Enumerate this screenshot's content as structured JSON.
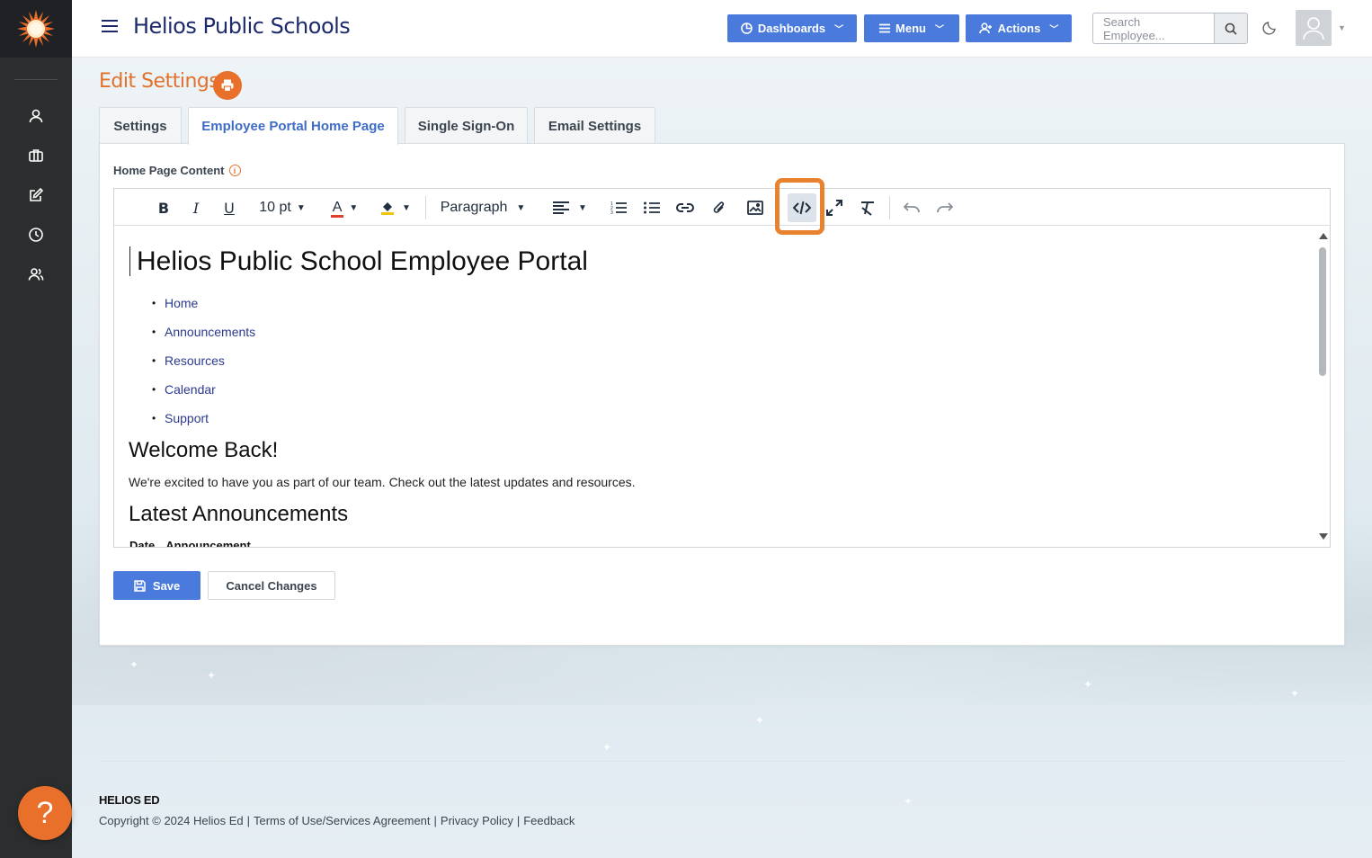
{
  "header": {
    "brand": "Helios Public Schools",
    "dashboards_label": "Dashboards",
    "menu_label": "Menu",
    "actions_label": "Actions",
    "search_placeholder": "Search Employee..."
  },
  "page": {
    "title": "Edit Settings",
    "tabs": [
      {
        "label": "Settings"
      },
      {
        "label": "Employee Portal Home Page"
      },
      {
        "label": "Single Sign-On"
      },
      {
        "label": "Email Settings"
      }
    ],
    "field_label": "Home Page Content"
  },
  "toolbar": {
    "font_size": "10 pt",
    "block_format": "Paragraph",
    "icons": [
      "bold-icon",
      "italic-icon",
      "underline-icon",
      "text-color-icon",
      "highlight-color-icon",
      "align-left-icon",
      "numbered-list-icon",
      "bullet-list-icon",
      "link-icon",
      "attachment-icon",
      "image-icon",
      "source-code-icon",
      "fullscreen-icon",
      "clear-formatting-icon",
      "undo-icon",
      "redo-icon"
    ]
  },
  "editor_content": {
    "heading": "Helios Public School Employee Portal",
    "nav_items": [
      "Home",
      "Announcements",
      "Resources",
      "Calendar",
      "Support"
    ],
    "welcome_heading": "Welcome Back!",
    "welcome_text": "We're excited to have you as part of our team. Check out the latest updates and resources.",
    "announcements_heading": "Latest Announcements",
    "table_headers": [
      "Date",
      "Announcement"
    ]
  },
  "actions": {
    "save_label": "Save",
    "cancel_label": "Cancel Changes"
  },
  "footer": {
    "brand": "HELIOS ED",
    "copyright": "Copyright © 2024 Helios Ed",
    "links": [
      "Terms of Use/Services Agreement",
      "Privacy Policy",
      "Feedback"
    ]
  },
  "colors": {
    "accent_orange": "#e8702a",
    "primary_blue": "#4a7bdc",
    "brand_navy": "#1d2a6b",
    "sidebar_dark": "#2b2d2e"
  }
}
